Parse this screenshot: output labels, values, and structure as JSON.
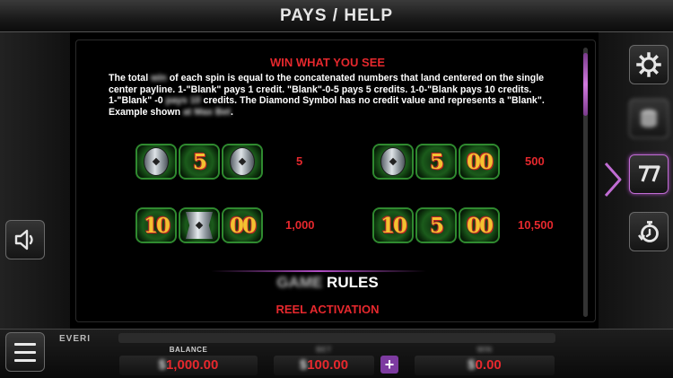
{
  "header": {
    "title": "PAYS / HELP"
  },
  "help": {
    "win_heading": "WIN WHAT YOU SEE",
    "paragraph_lines": [
      [
        "The total ",
        "win",
        " of each  spin is equal to the concatenated numbers that land centered on the single"
      ],
      [
        "center payline. 1-\"Blank\" pays 1 credit. \"Blank\"-0-5 pays 5 credits. 1-0-\"Blank pays 10 credits.",
        "",
        ""
      ],
      [
        "1-\"Blank\" -0 ",
        "pays 10",
        " credits. The Diamond Symbol has no credit value and represents a \"Blank\"."
      ],
      [
        "Example shown ",
        "at Max Bet",
        "."
      ]
    ],
    "combos": [
      {
        "symbols": [
          "diamond",
          "5",
          "diamond"
        ],
        "payout": "5"
      },
      {
        "symbols": [
          "diamond",
          "5",
          "00"
        ],
        "payout": "500"
      },
      {
        "symbols": [
          "10",
          "blank",
          "00"
        ],
        "payout": "1,000"
      },
      {
        "symbols": [
          "10",
          "5",
          "00"
        ],
        "payout": "10,500"
      }
    ],
    "rules_heading_blurred": "GAME",
    "rules_heading": "RULES",
    "reel_activation": "REEL ACTIVATION"
  },
  "side_buttons": {
    "left": [
      "speaker-icon"
    ],
    "right": [
      "gear-icon",
      "coin-stack-icon",
      "sevens-icon",
      "stopwatch-icon"
    ]
  },
  "bottom": {
    "brand": "EVERI",
    "balance": {
      "label": "BALANCE",
      "value_prefix": "$",
      "value": "1,000.00"
    },
    "bet": {
      "label": "BET",
      "value_prefix": "$",
      "value": "100.00"
    },
    "win": {
      "label": "WIN",
      "value_prefix": "$",
      "value": "0.00"
    },
    "plus_label": "+"
  },
  "colors": {
    "accent_red": "#e5282d",
    "accent_purple": "#b04ec3",
    "symbol_green": "#2f8a2f"
  }
}
